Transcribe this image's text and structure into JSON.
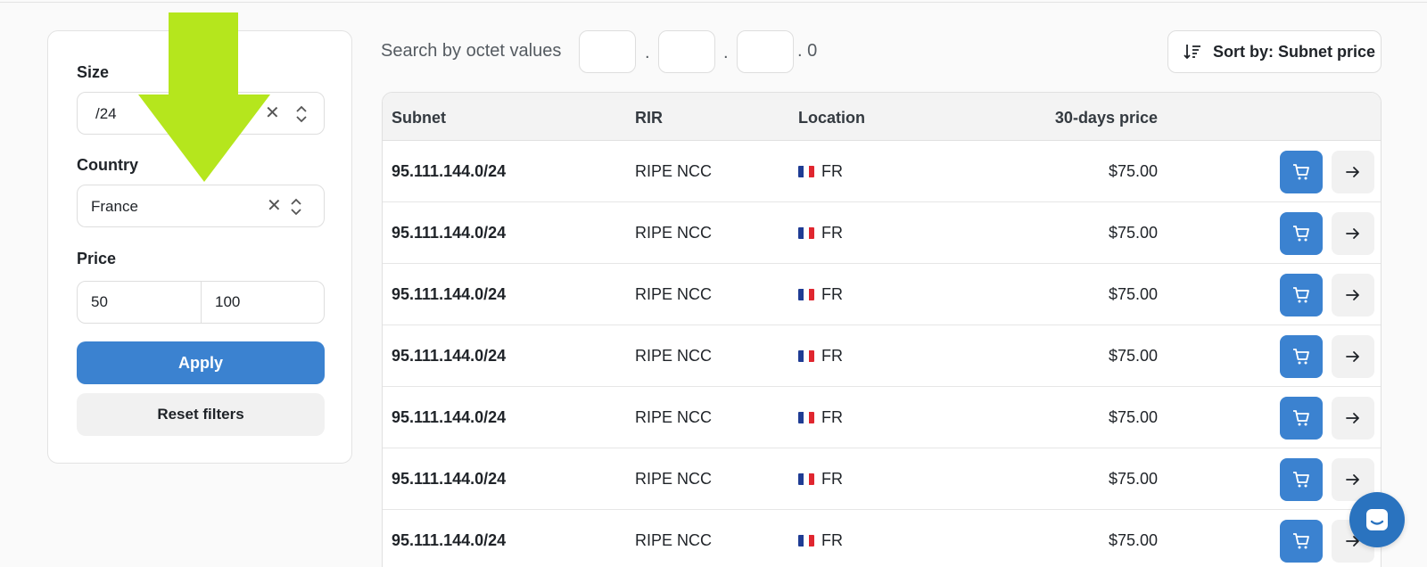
{
  "filters": {
    "size_label": "Size",
    "size_value": "/24",
    "country_label": "Country",
    "country_value": "France",
    "price_label": "Price",
    "price_min": "50",
    "price_max": "100",
    "apply_label": "Apply",
    "reset_label": "Reset filters"
  },
  "search": {
    "label": "Search by octet values",
    "octet_sep": ".",
    "last_octet": ". 0"
  },
  "sort": {
    "label": "Sort by: Subnet price"
  },
  "table": {
    "headers": {
      "subnet": "Subnet",
      "rir": "RIR",
      "location": "Location",
      "price": "30-days price"
    },
    "rows": [
      {
        "subnet": "95.111.144.0/24",
        "rir": "RIPE NCC",
        "country": "FR",
        "price": "$75.00"
      },
      {
        "subnet": "95.111.144.0/24",
        "rir": "RIPE NCC",
        "country": "FR",
        "price": "$75.00"
      },
      {
        "subnet": "95.111.144.0/24",
        "rir": "RIPE NCC",
        "country": "FR",
        "price": "$75.00"
      },
      {
        "subnet": "95.111.144.0/24",
        "rir": "RIPE NCC",
        "country": "FR",
        "price": "$75.00"
      },
      {
        "subnet": "95.111.144.0/24",
        "rir": "RIPE NCC",
        "country": "FR",
        "price": "$75.00"
      },
      {
        "subnet": "95.111.144.0/24",
        "rir": "RIPE NCC",
        "country": "FR",
        "price": "$75.00"
      },
      {
        "subnet": "95.111.144.0/24",
        "rir": "RIPE NCC",
        "country": "FR",
        "price": "$75.00"
      }
    ]
  },
  "icons": {
    "cart": "cart-icon",
    "arrow_right": "arrow-right-icon",
    "sort": "sort-icon",
    "chat": "chat-icon",
    "clear": "close-icon",
    "updown": "chevron-updown-icon",
    "flag": "france-flag-icon"
  },
  "colors": {
    "primary": "#3b82d0",
    "overlay_arrow": "#b5e61d",
    "flag_blue": "#1f3c94",
    "flag_white": "#ffffff",
    "flag_red": "#e0262f"
  }
}
